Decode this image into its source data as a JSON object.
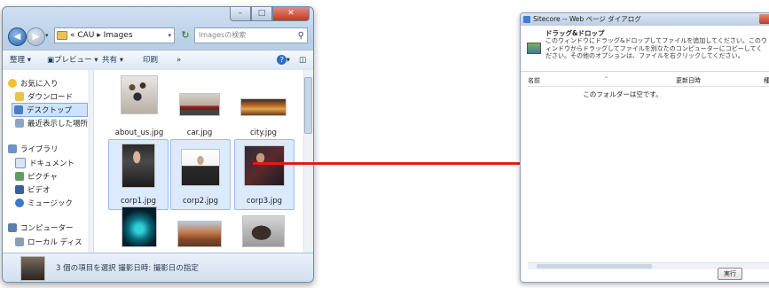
{
  "explorer": {
    "breadcrumb": "« CAU ▸ Images",
    "search_placeholder": "Imagesの検索",
    "toolbar": {
      "organize": "整理 ▾",
      "preview": "プレビュー ▾",
      "share": "共有 ▾",
      "print": "印刷",
      "more": "»"
    },
    "nav": {
      "favorites": "お気に入り",
      "downloads": "ダウンロード",
      "desktop": "デスクトップ",
      "recent": "最近表示した場所",
      "libraries": "ライブラリ",
      "documents": "ドキュメント",
      "pictures": "ピクチャ",
      "videos": "ビデオ",
      "music": "ミュージック",
      "computer": "コンピューター",
      "local_disk": "ローカル ディス"
    },
    "files": [
      {
        "name": "about_us.jpg",
        "selected": false
      },
      {
        "name": "car.jpg",
        "selected": false
      },
      {
        "name": "city.jpg",
        "selected": false
      },
      {
        "name": "corp1.jpg",
        "selected": true
      },
      {
        "name": "corp2.jpg",
        "selected": true
      },
      {
        "name": "corp3.jpg",
        "selected": true
      },
      {
        "name": "",
        "selected": false
      },
      {
        "name": "",
        "selected": false
      },
      {
        "name": "",
        "selected": false
      }
    ],
    "status": "3 個の項目を選択  撮影日時: 撮影日の指定"
  },
  "dialog": {
    "title": "Sitecore -- Web ページ ダイアログ",
    "header_title": "ドラッグ&ドロップ",
    "header_desc": "このウィンドウにドラッグ&ドロップしてファイルを追加してください。このウィンドウからドラッグしてファイルを別なたのコンピューターにコピーしてください。その他のオプションは、ファイルを右クリックしてください。",
    "col_name": "名前",
    "col_modified": "更新日時",
    "col_type": "種類",
    "empty_text": "このフォルダーは空です。",
    "run_button": "実行"
  },
  "colors": {
    "arrow": "#e51b1b",
    "selection": "#dbeafc"
  }
}
